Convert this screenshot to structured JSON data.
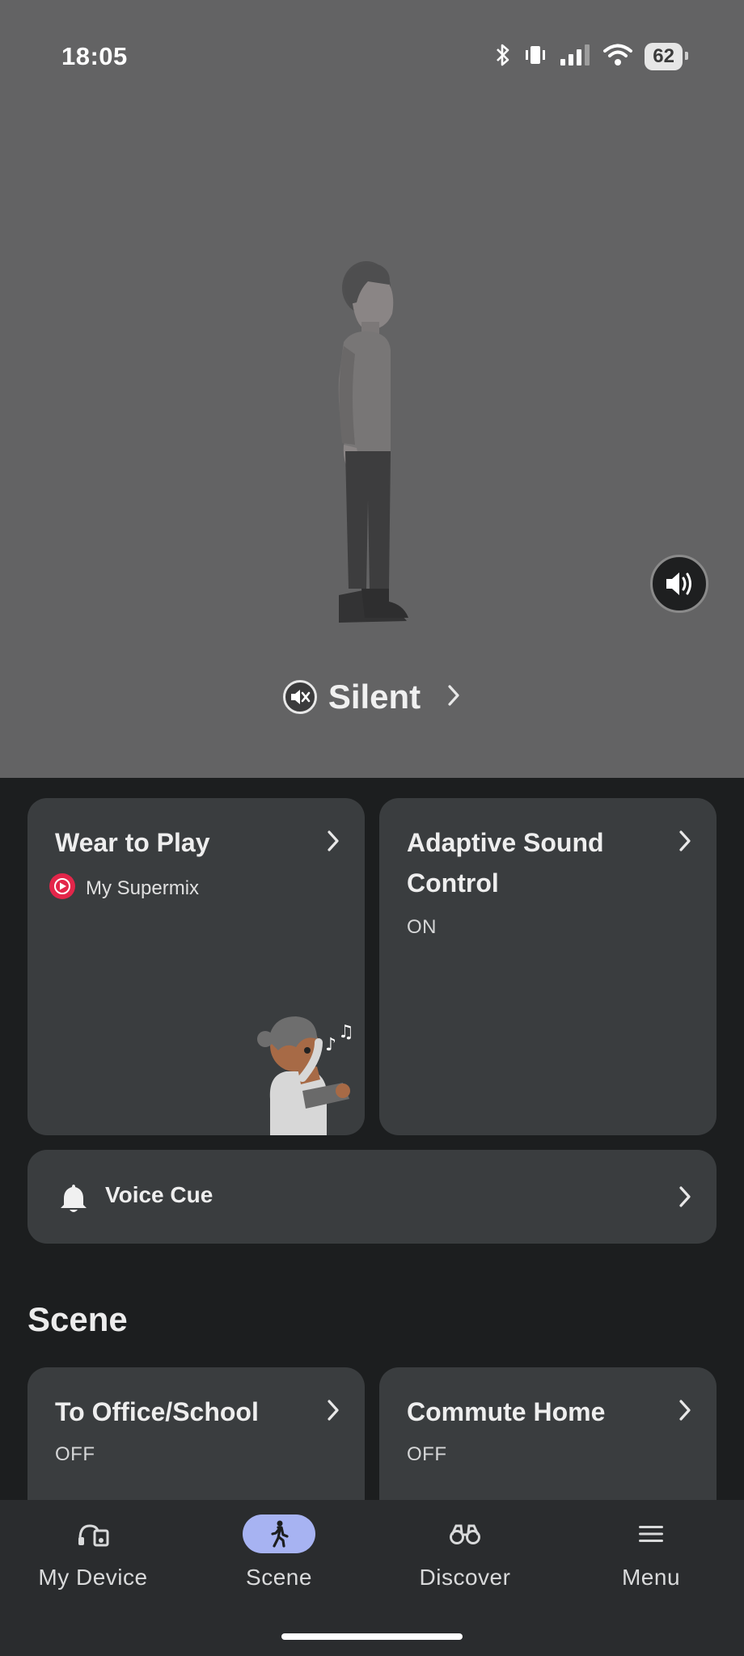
{
  "status_bar": {
    "time": "18:05",
    "battery": "62",
    "icons": [
      "bluetooth-icon",
      "vibrate-icon",
      "signal-icon",
      "wifi-icon",
      "battery-icon"
    ]
  },
  "hero": {
    "mode_label": "Silent",
    "volume_icon": "speaker-icon"
  },
  "cards": {
    "wear_to_play": {
      "title": "Wear to Play",
      "source": "My Supermix"
    },
    "adaptive": {
      "title_line1": "Adaptive Sound",
      "title_line2": "Control",
      "status": "ON"
    },
    "voice_cue": {
      "title": "Voice Cue"
    }
  },
  "scene": {
    "heading": "Scene",
    "items": [
      {
        "title": "To Office/School",
        "status": "OFF"
      },
      {
        "title": "Commute Home",
        "status": "OFF"
      }
    ]
  },
  "nav": {
    "items": [
      {
        "label": "My Device",
        "icon": "headphones-speaker-icon"
      },
      {
        "label": "Scene",
        "icon": "walking-person-icon"
      },
      {
        "label": "Discover",
        "icon": "binoculars-icon"
      },
      {
        "label": "Menu",
        "icon": "hamburger-icon"
      }
    ],
    "active": "Scene"
  },
  "colors": {
    "hero_bg": "#636364",
    "page_bg": "#1c1e1f",
    "card_bg": "#3a3d3f",
    "nav_active": "#a7b3f2",
    "music_badge": "#e3264a"
  }
}
